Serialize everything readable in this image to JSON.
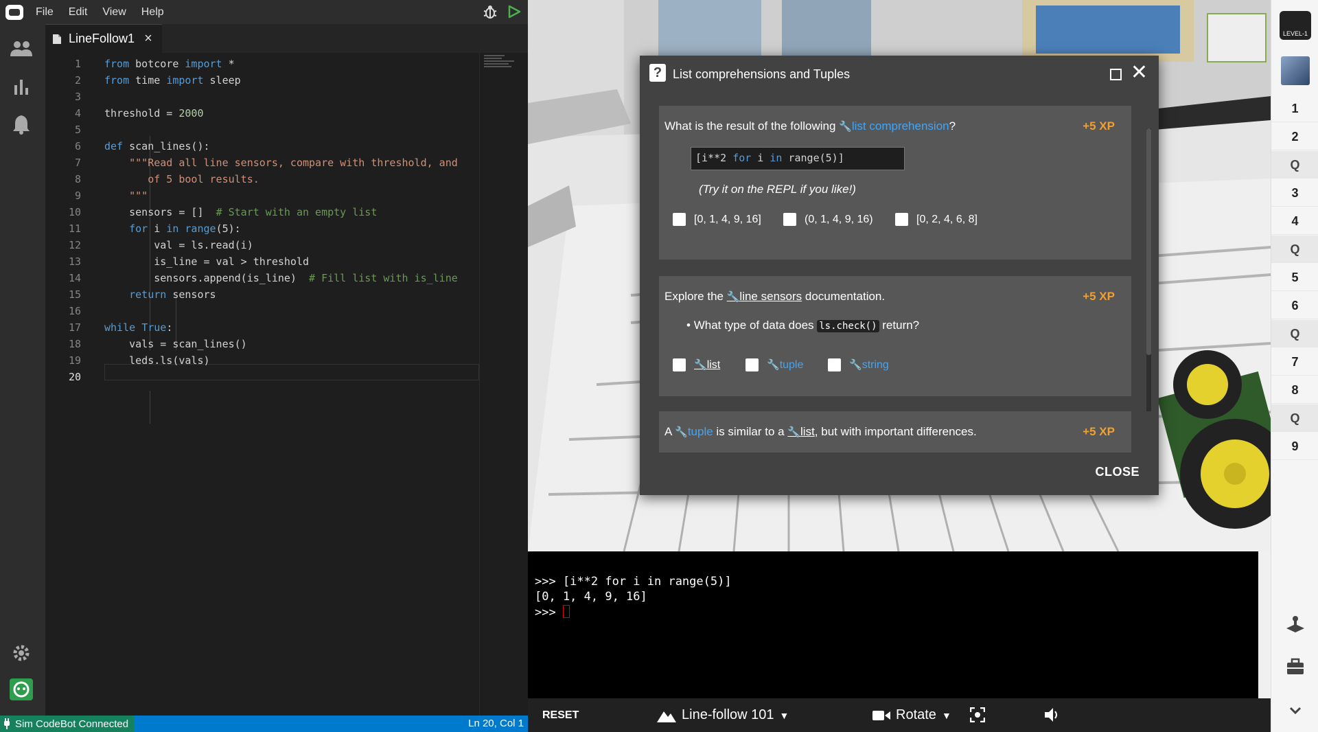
{
  "menu": {
    "items": [
      "File",
      "Edit",
      "View",
      "Help"
    ]
  },
  "editor": {
    "tab_label": "LineFollow1",
    "cursor_line": 20
  },
  "status": {
    "connection": "Sim CodeBot Connected",
    "position": "Ln 20, Col 1"
  },
  "modal": {
    "title": "List comprehensions and Tuples",
    "q1": {
      "prefix": "What is the result of the following ",
      "link": "list comprehension",
      "suffix": "?",
      "xp": "+5 XP",
      "code_prefix": "[i**2 ",
      "code_for": "for",
      "code_mid": " i ",
      "code_in": "in",
      "code_range": " range(5)]",
      "hint": "(Try it on the REPL if you like!)",
      "options": [
        "[0, 1, 4, 9, 16]",
        "(0, 1, 4, 9, 16)",
        "[0, 2, 4, 6, 8]"
      ]
    },
    "q2": {
      "prefix": "Explore the ",
      "link": "line sensors",
      "suffix": " documentation.",
      "xp": "+5 XP",
      "bullet_prefix": "What type of data does ",
      "bullet_code": "ls.check()",
      "bullet_suffix": " return?",
      "options": [
        "list",
        "tuple",
        "string"
      ]
    },
    "q3": {
      "prefix": "A ",
      "link1": "tuple",
      "mid": " is similar to a ",
      "link2": "list",
      "suffix": ", but with important differences.",
      "xp": "+5 XP"
    },
    "close_label": "CLOSE"
  },
  "repl": {
    "line1": ">>> [i**2 for i in range(5)]",
    "line2": "[0, 1, 4, 9, 16]",
    "prompt": ">>> "
  },
  "bottombar": {
    "reset": "RESET",
    "level": "Line-follow 101",
    "camera": "Rotate"
  },
  "levelbar": {
    "badge": "LEVEL-1",
    "items": [
      "1",
      "2",
      "Q",
      "3",
      "4",
      "Q",
      "5",
      "6",
      "Q",
      "7",
      "8",
      "Q",
      "9"
    ]
  },
  "colors": {
    "status_bar": "#007acc",
    "status_connected": "#16825d",
    "xp": "#f0a030",
    "link": "#42a5f5"
  }
}
